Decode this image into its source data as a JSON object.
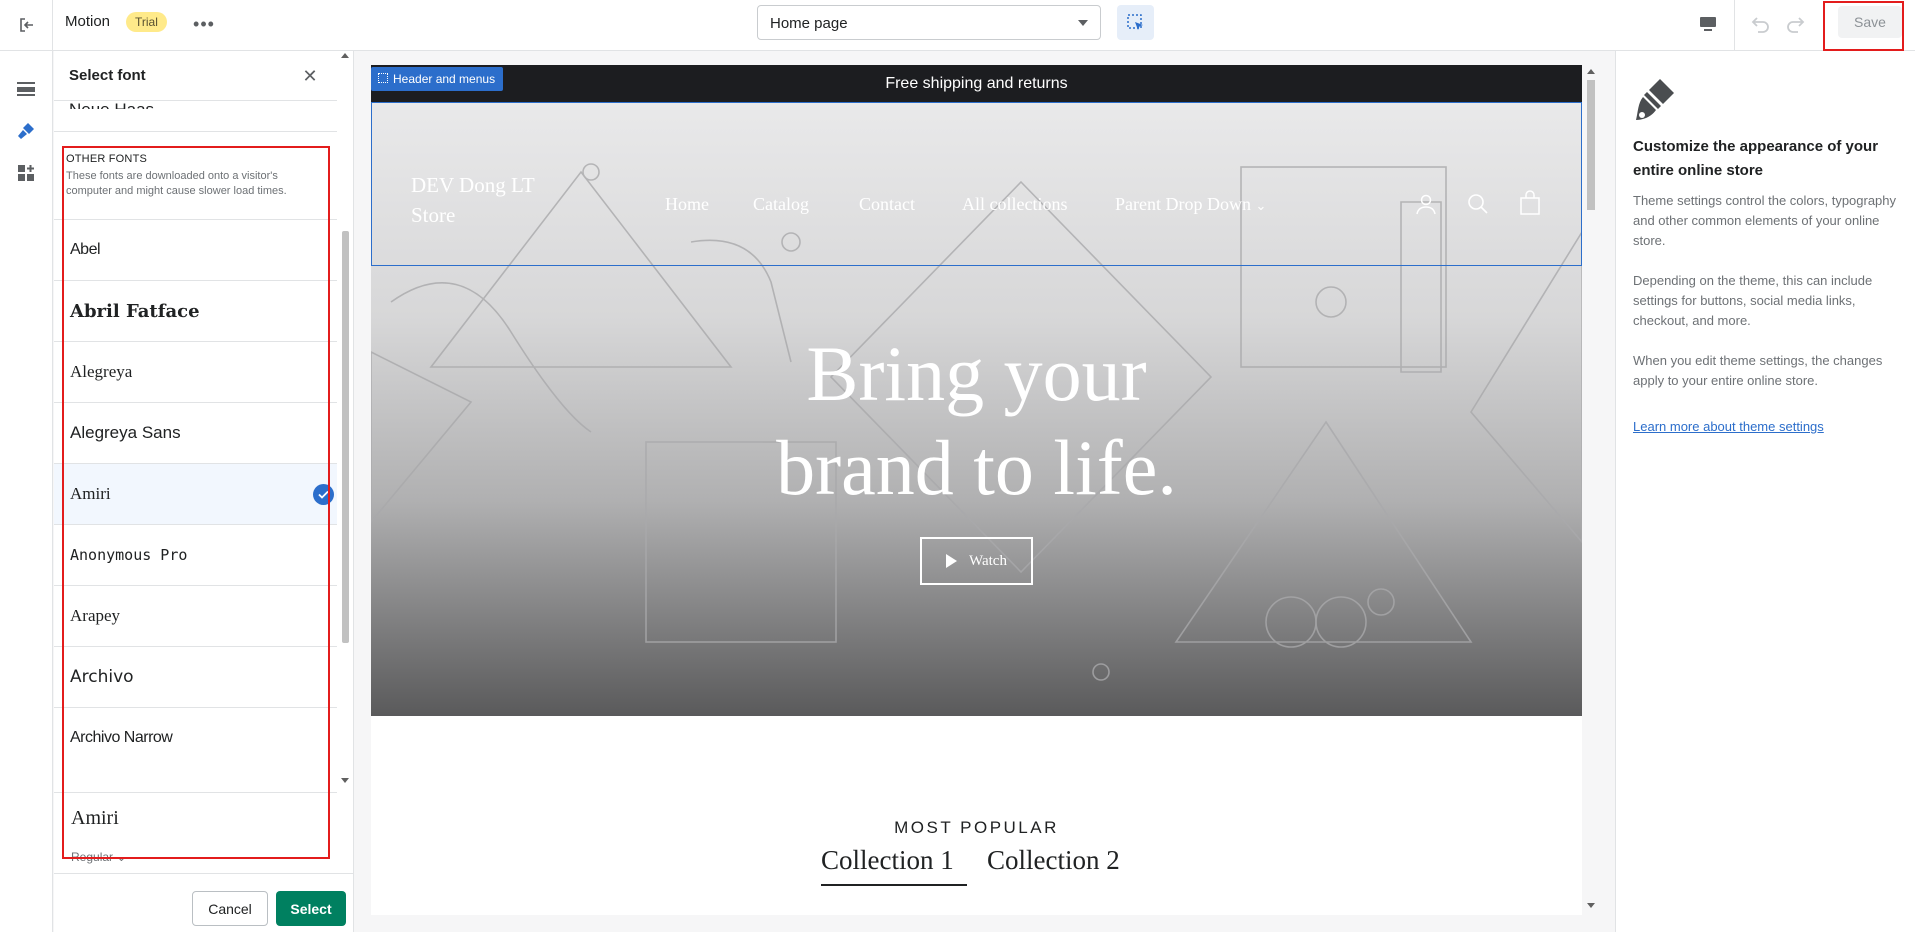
{
  "topbar": {
    "theme_name": "Motion",
    "badge": "Trial",
    "page_select": "Home page",
    "save_label": "Save"
  },
  "font_panel": {
    "title": "Select font",
    "cut_item": "Neue Haas",
    "other_fonts_title": "Other fonts",
    "other_fonts_desc": "These fonts are downloaded onto a visitor's computer and might cause slower load times.",
    "fonts": [
      {
        "name": "Abel",
        "family": "\"Liberation Sans\", sans-serif"
      },
      {
        "name": "Abril Fatface",
        "family": "\"DejaVu Serif\", serif"
      },
      {
        "name": "Alegreya",
        "family": "\"Liberation Serif\", serif"
      },
      {
        "name": "Alegreya Sans",
        "family": "\"Liberation Sans\", sans-serif"
      },
      {
        "name": "Amiri",
        "family": "\"Liberation Serif\", serif"
      },
      {
        "name": "Anonymous Pro",
        "family": "\"DejaVu Sans Mono\", monospace"
      },
      {
        "name": "Arapey",
        "family": "\"Liberation Serif\", serif"
      },
      {
        "name": "Archivo",
        "family": "\"DejaVu Sans\", sans-serif"
      },
      {
        "name": "Archivo Narrow",
        "family": "\"Liberation Sans\", sans-serif"
      }
    ],
    "selected_font": "Amiri",
    "current_font": "Amiri",
    "current_style": "Regular",
    "cancel_label": "Cancel",
    "select_label": "Select"
  },
  "preview": {
    "announcement": "Free shipping and returns",
    "section_badge": "Header and menus",
    "store_name": "DEV Dong LT Store",
    "nav": [
      "Home",
      "Catalog",
      "Contact",
      "All collections",
      "Parent Drop Down"
    ],
    "hero_line1": "Bring your",
    "hero_line2": "brand to life.",
    "watch_label": "Watch",
    "most_popular": "MOST POPULAR",
    "collections": [
      "Collection 1",
      "Collection 2"
    ]
  },
  "right_panel": {
    "title": "Customize the appearance of your entire online store",
    "p1": "Theme settings control the colors, typography and other common elements of your online store.",
    "p2": "Depending on the theme, this can include settings for buttons, social media links, checkout, and more.",
    "p3": "When you edit theme settings, the changes apply to your entire online store.",
    "link": "Learn more about theme settings"
  },
  "colors": {
    "primary_green": "#008060",
    "accent_blue": "#2c6ecb",
    "highlight_red": "#e31c1c",
    "trial_yellow": "#ffea8a"
  }
}
